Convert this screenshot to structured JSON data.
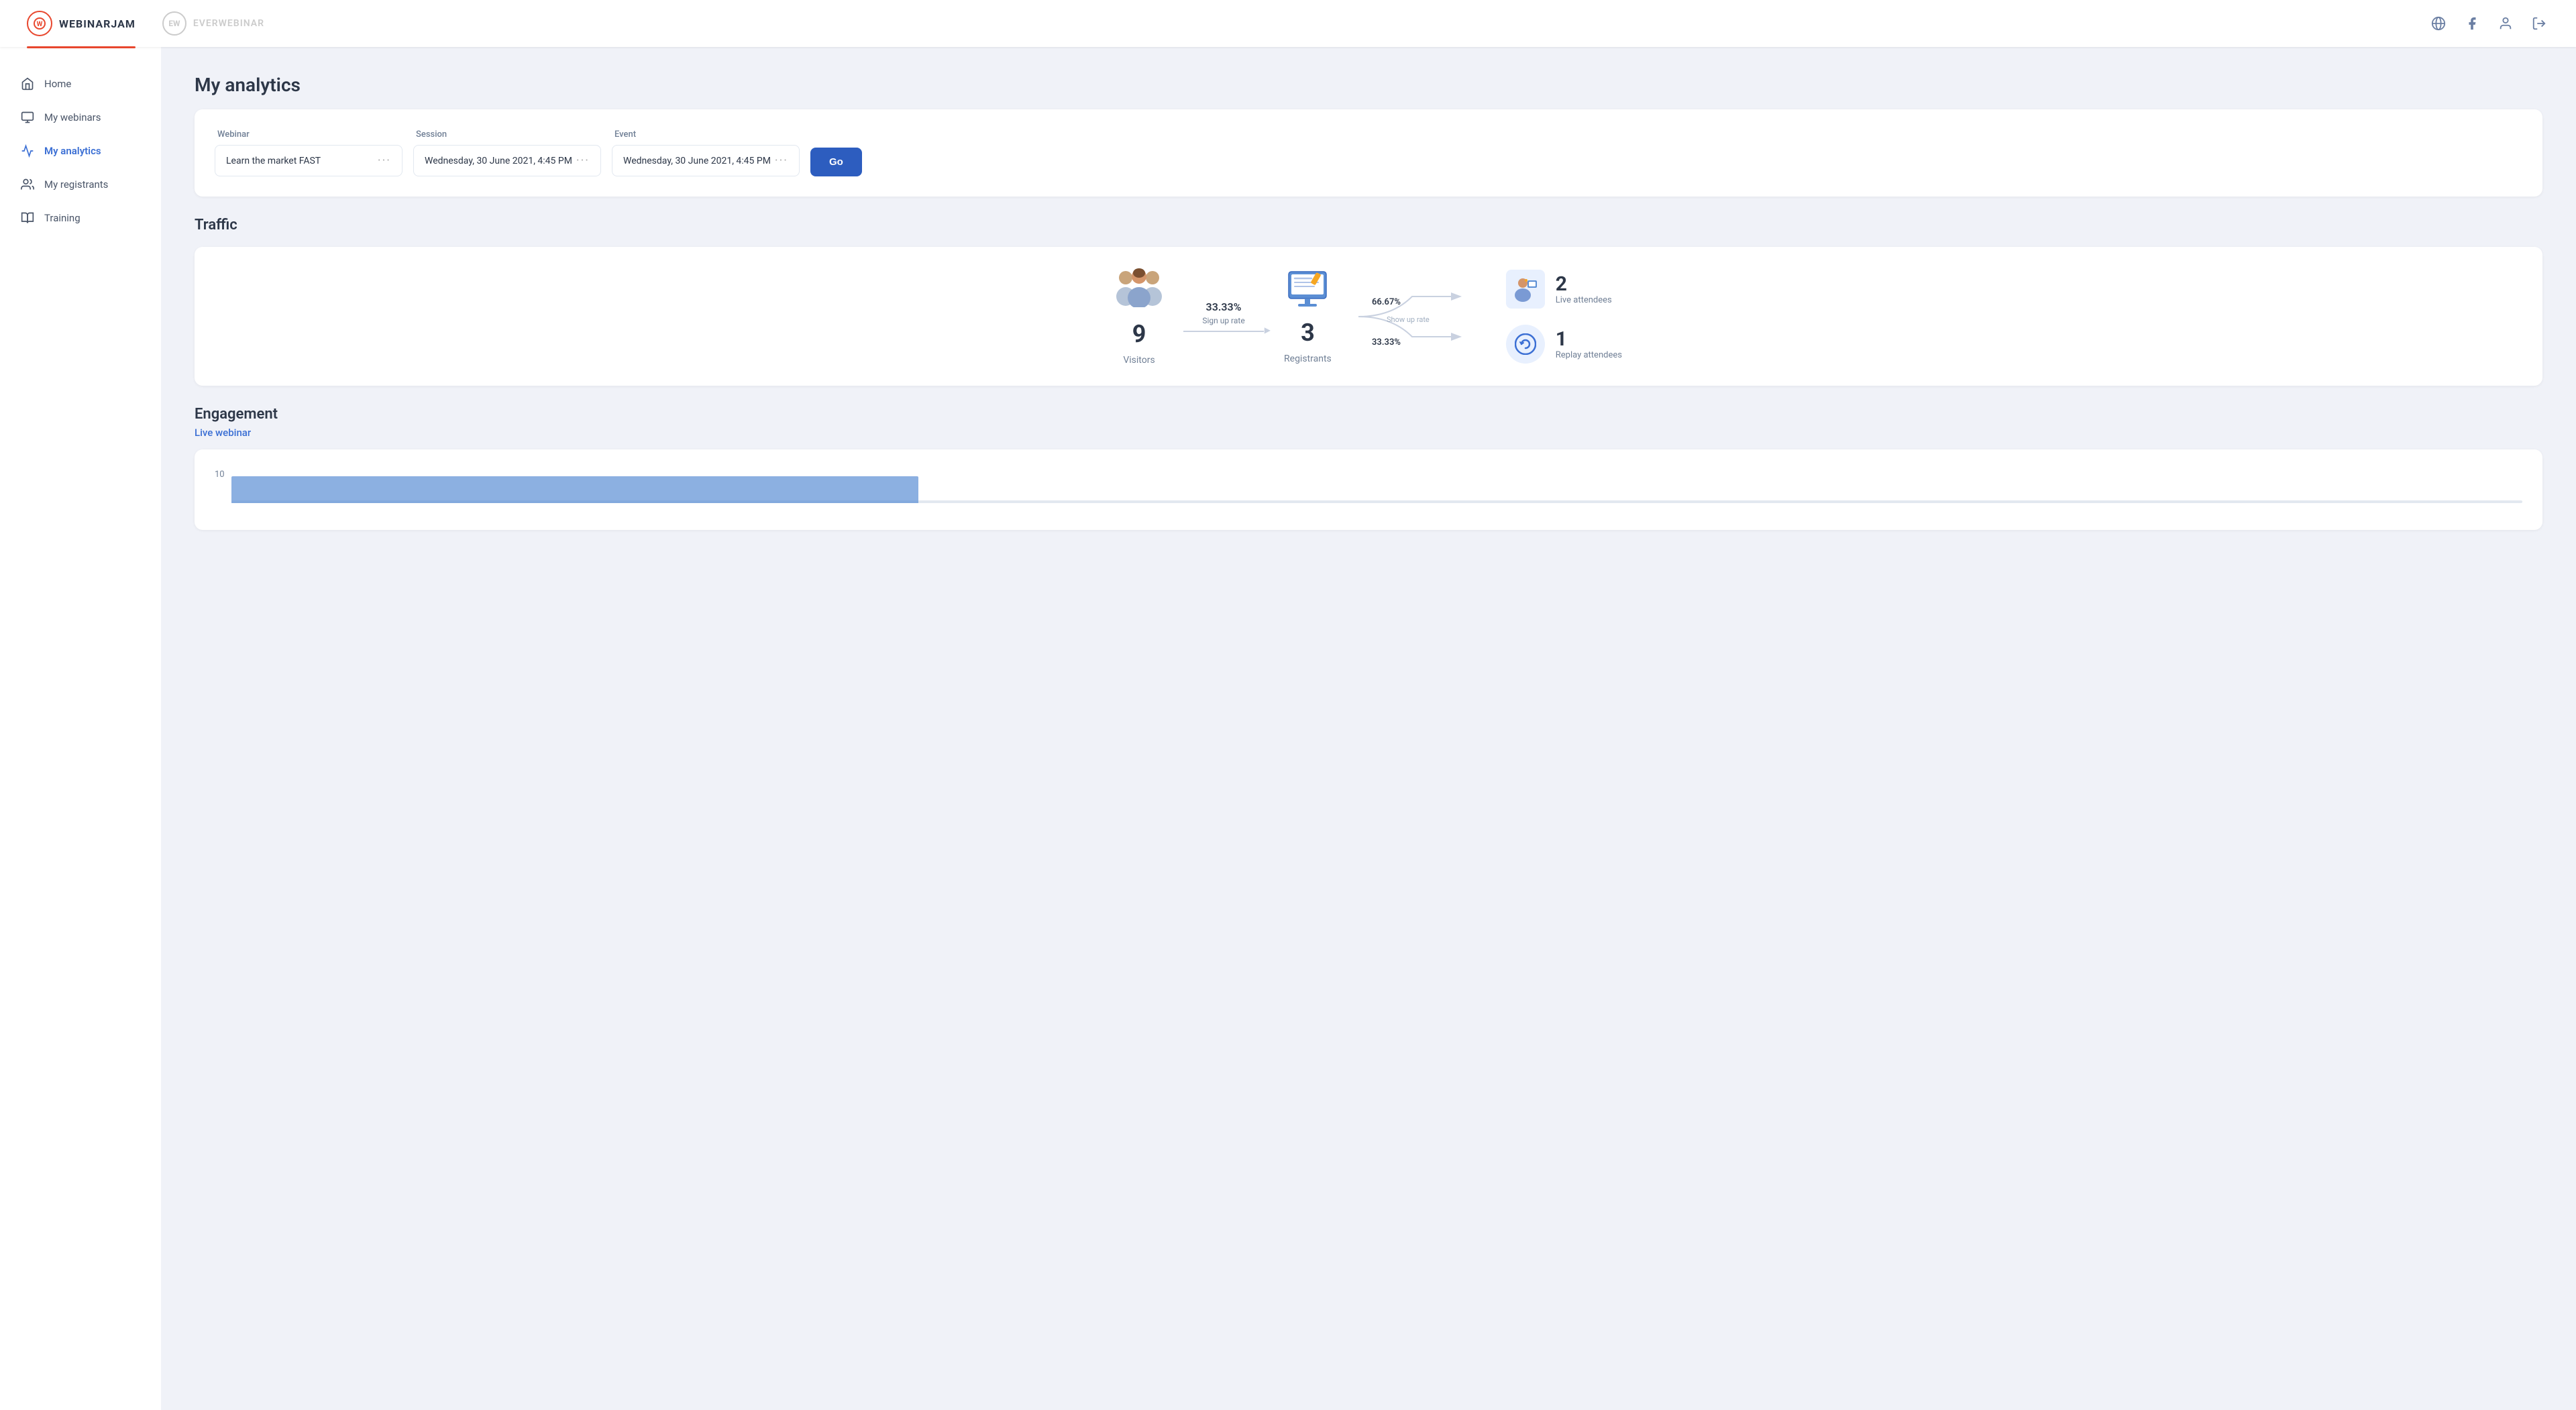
{
  "header": {
    "logo_wj_text": "WEBINARJAM",
    "logo_wj_initials": "W",
    "logo_ew_text": "EVERWEBINAR",
    "logo_ew_initials": "EW"
  },
  "sidebar": {
    "items": [
      {
        "id": "home",
        "label": "Home",
        "icon": "home-icon",
        "active": false
      },
      {
        "id": "my-webinars",
        "label": "My webinars",
        "icon": "monitor-icon",
        "active": false
      },
      {
        "id": "my-analytics",
        "label": "My analytics",
        "icon": "analytics-icon",
        "active": true
      },
      {
        "id": "my-registrants",
        "label": "My registrants",
        "icon": "registrants-icon",
        "active": false
      },
      {
        "id": "training",
        "label": "Training",
        "icon": "training-icon",
        "active": false
      }
    ]
  },
  "page": {
    "title": "My analytics",
    "filter": {
      "webinar_label": "Webinar",
      "session_label": "Session",
      "event_label": "Event",
      "webinar_value": "Learn the market FAST",
      "session_value": "Wednesday, 30 June 2021, 4:45 PM",
      "event_value": "Wednesday, 30 June 2021, 4:45 PM",
      "go_button": "Go"
    },
    "traffic": {
      "section_title": "Traffic",
      "visitors_count": "9",
      "visitors_label": "Visitors",
      "sign_up_rate": "33.33%",
      "sign_up_label": "Sign up rate",
      "registrants_count": "3",
      "registrants_label": "Registrants",
      "show_up_rate_live": "66.67%",
      "show_up_rate_replay": "33.33%",
      "show_up_label": "Show up rate",
      "live_attendees_count": "2",
      "live_attendees_label": "Live attendees",
      "replay_attendees_count": "1",
      "replay_attendees_label": "Replay attendees"
    },
    "engagement": {
      "section_title": "Engagement",
      "live_webinar_label": "Live webinar",
      "chart_max": "10"
    }
  }
}
